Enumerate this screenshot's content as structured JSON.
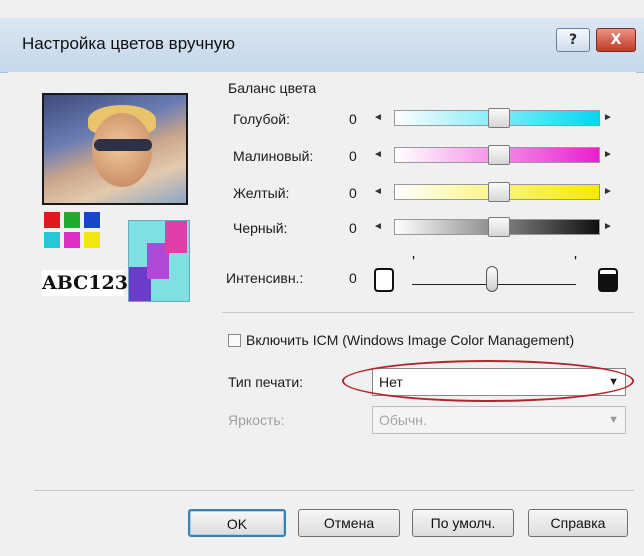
{
  "window": {
    "title": "Настройка цветов вручную",
    "help_label": "?",
    "close_label": "X"
  },
  "preview": {
    "sample_text": "ABC123",
    "swatch_colors": [
      "#e0191e",
      "#1faa2e",
      "#1646c8",
      "#27c7d6",
      "#e02ec2",
      "#f1e70f"
    ]
  },
  "color_balance": {
    "heading": "Баланс цвета",
    "sliders": [
      {
        "label": "Голубой:",
        "value": "0",
        "color": "#00d8f0"
      },
      {
        "label": "Малиновый:",
        "value": "0",
        "color": "#e91fd0"
      },
      {
        "label": "Желтый:",
        "value": "0",
        "color": "#f5ea00"
      },
      {
        "label": "Черный:",
        "value": "0",
        "color": "#101010"
      }
    ],
    "arrow_left": "◄",
    "arrow_right": "►"
  },
  "intensity": {
    "label": "Интенсивн.:",
    "value": "0",
    "tick_mark": "'"
  },
  "icm": {
    "checkbox_label": "Включить ICM (Windows Image Color Management)",
    "checked": false
  },
  "print_type": {
    "label": "Тип печати:",
    "value": "Нет",
    "dropdown_arrow": "▼"
  },
  "brightness": {
    "label": "Яркость:",
    "value": "Обычн.",
    "dropdown_arrow": "▼"
  },
  "buttons": {
    "ok": "OK",
    "cancel": "Отмена",
    "defaults": "По умолч.",
    "help": "Справка"
  },
  "colors": {
    "annotation_circle": "#b0262a",
    "title_bar": "#c5d7ea",
    "close_button": "#c13b25"
  }
}
